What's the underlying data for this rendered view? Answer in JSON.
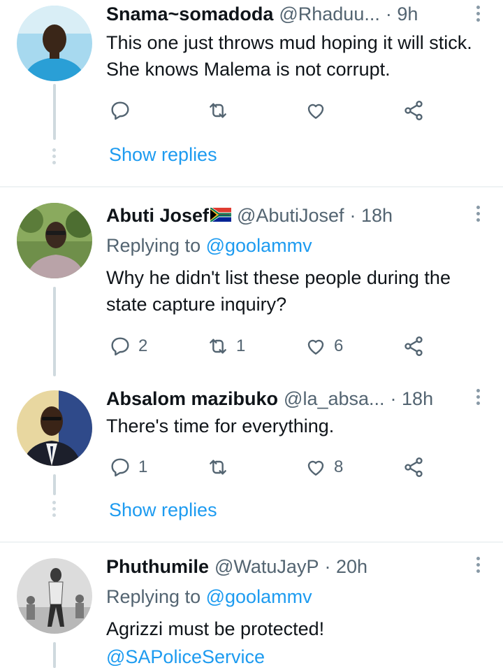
{
  "tweets": [
    {
      "name": "Snama~somadoda",
      "handle": "@Rhaduu...",
      "time": "· 9h",
      "text": "This one just throws mud hoping it will stick. She knows Malema is not corrupt.",
      "counts": {
        "reply": "",
        "retweet": "",
        "like": ""
      },
      "show_replies": "Show replies"
    },
    {
      "name": "Abuti Josef",
      "handle": "@AbutiJosef",
      "time": "· 18h",
      "replying_prefix": "Replying to",
      "replying_to": "@goolammv",
      "text": "Why he didn't list these people during the state capture inquiry?",
      "counts": {
        "reply": "2",
        "retweet": "1",
        "like": "6"
      }
    },
    {
      "name": "Absalom mazibuko",
      "handle": "@la_absa...",
      "time": "· 18h",
      "text": "There's time for everything.",
      "counts": {
        "reply": "1",
        "retweet": "",
        "like": "8"
      },
      "show_replies": "Show replies"
    },
    {
      "name": "Phuthumile",
      "handle": "@WatuJayP",
      "time": "· 20h",
      "replying_prefix": "Replying to",
      "replying_to": "@goolammv",
      "text": "Agrizzi must be protected!",
      "mention": "@SAPoliceService"
    }
  ],
  "colors": {
    "link": "#1d9bf0",
    "secondary": "#536471",
    "line": "#cfd9de"
  },
  "icons": [
    "reply-icon",
    "retweet-icon",
    "like-icon",
    "share-icon",
    "more-icon",
    "south-africa-flag-icon"
  ]
}
